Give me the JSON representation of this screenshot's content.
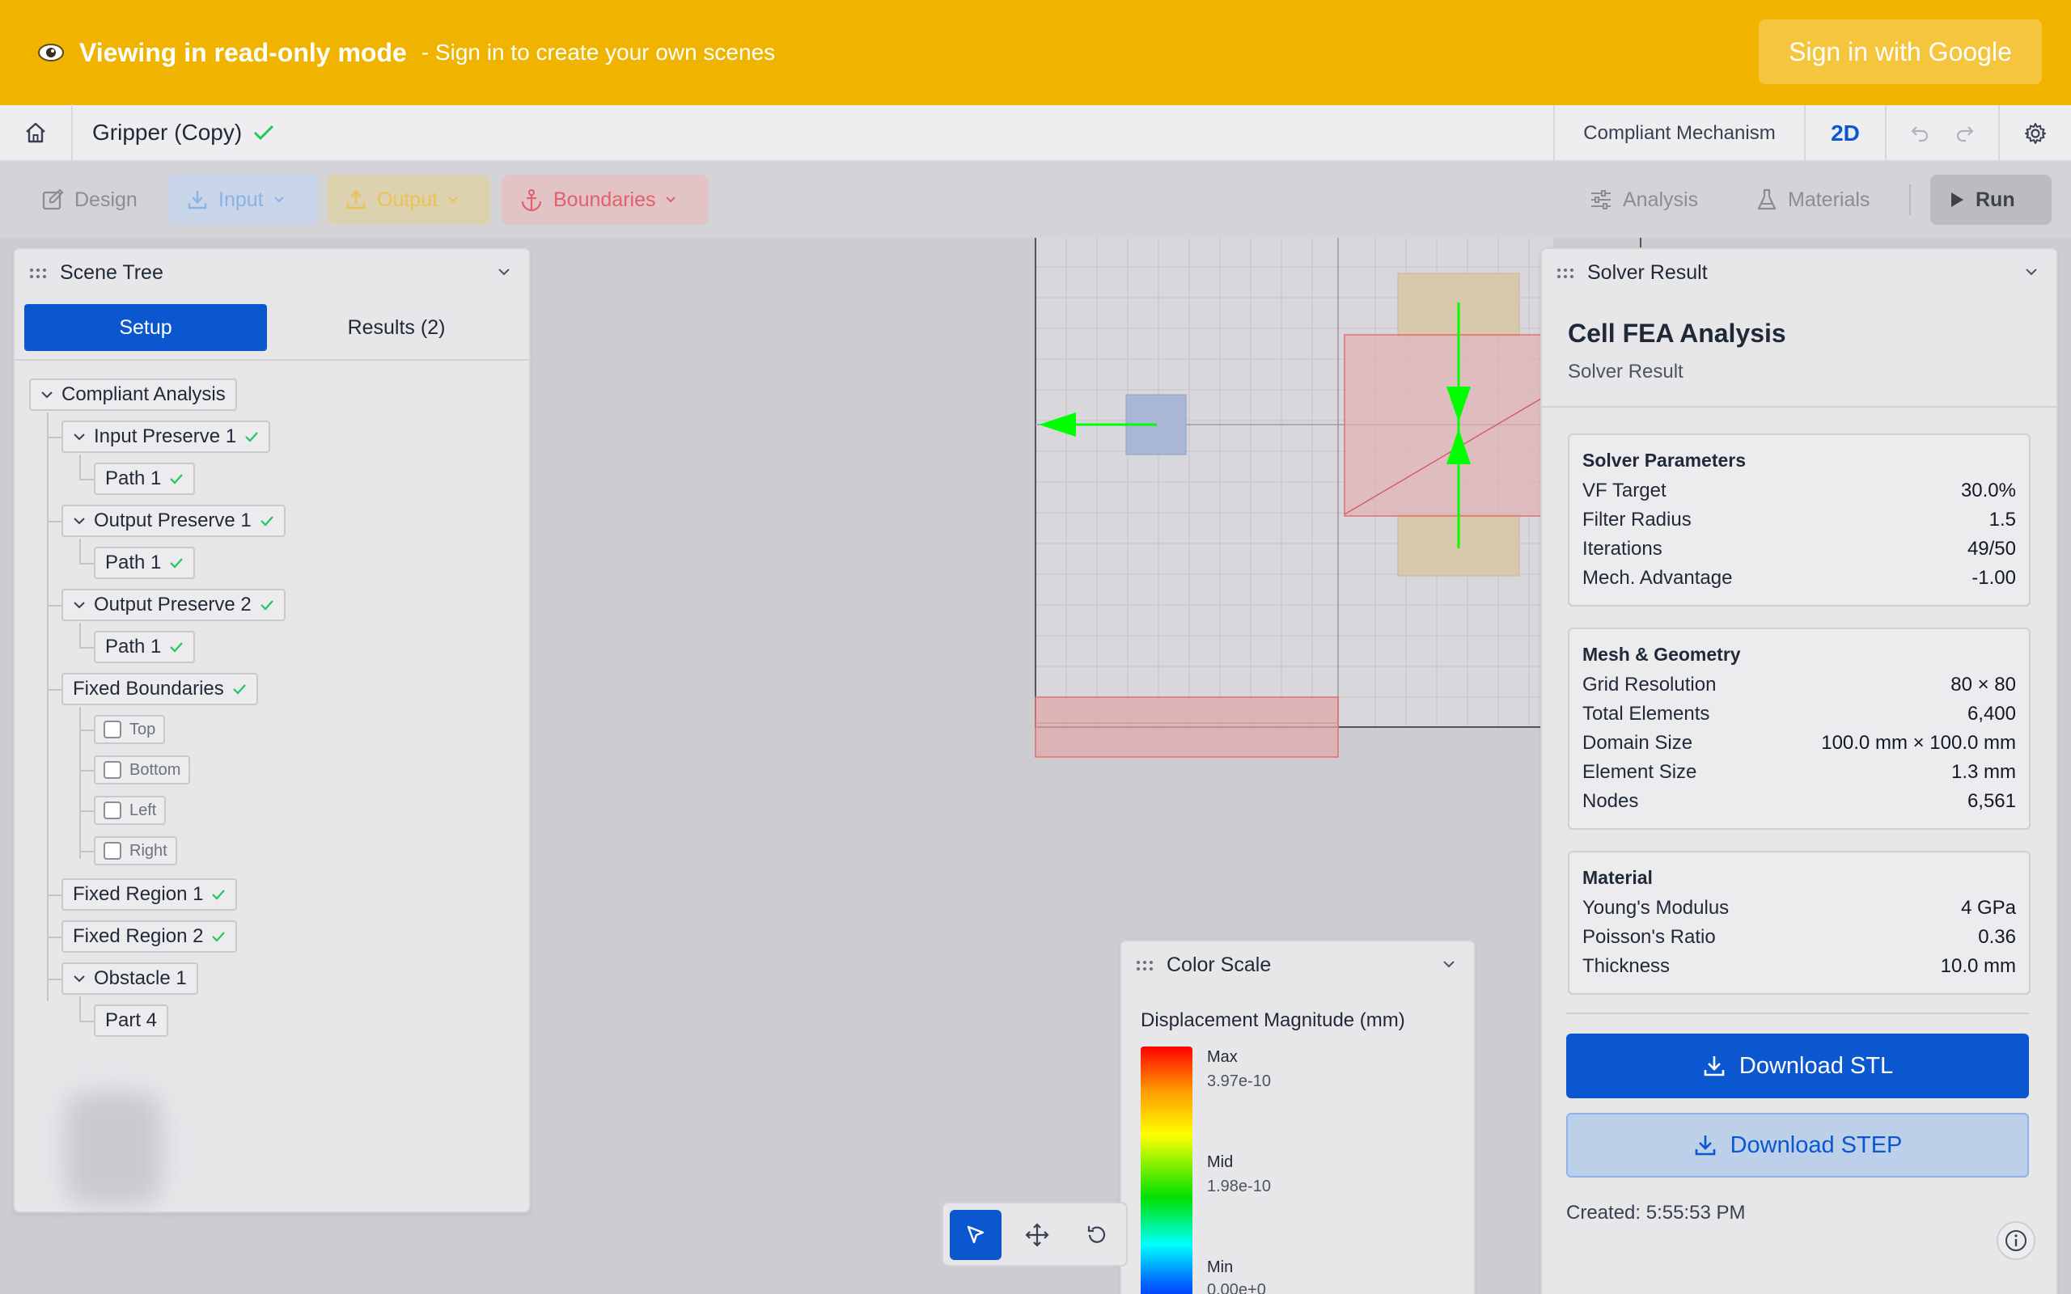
{
  "banner": {
    "title": "Viewing in read-only mode",
    "subtitle": "- Sign in to create your own scenes",
    "signin_label": "Sign in with Google"
  },
  "header": {
    "doc_title": "Gripper (Copy)",
    "mode": "Compliant Mechanism",
    "view": "2D"
  },
  "toolbar": {
    "design": "Design",
    "input": "Input",
    "output": "Output",
    "boundaries": "Boundaries",
    "analysis": "Analysis",
    "materials": "Materials",
    "run": "Run"
  },
  "scene_tree": {
    "title": "Scene Tree",
    "tab_setup": "Setup",
    "tab_results": "Results (2)",
    "root": "Compliant Analysis",
    "input_preserve_1": "Input Preserve 1",
    "output_preserve_1": "Output Preserve 1",
    "output_preserve_2": "Output Preserve 2",
    "path": "Path 1",
    "fixed_boundaries": "Fixed Boundaries",
    "top": "Top",
    "bottom": "Bottom",
    "left": "Left",
    "right": "Right",
    "fixed_region_1": "Fixed Region 1",
    "fixed_region_2": "Fixed Region 2",
    "obstacle_1": "Obstacle 1",
    "part_4": "Part 4"
  },
  "solver": {
    "panel_title": "Solver Result",
    "title": "Cell FEA Analysis",
    "subtitle": "Solver Result",
    "params": {
      "heading": "Solver Parameters",
      "rows": [
        {
          "label": "VF Target",
          "value": "30.0%"
        },
        {
          "label": "Filter Radius",
          "value": "1.5"
        },
        {
          "label": "Iterations",
          "value": "49/50"
        },
        {
          "label": "Mech. Advantage",
          "value": "-1.00"
        }
      ]
    },
    "mesh": {
      "heading": "Mesh & Geometry",
      "rows": [
        {
          "label": "Grid Resolution",
          "value": "80 × 80"
        },
        {
          "label": "Total Elements",
          "value": "6,400"
        },
        {
          "label": "Domain Size",
          "value": "100.0 mm × 100.0 mm"
        },
        {
          "label": "Element Size",
          "value": "1.3 mm"
        },
        {
          "label": "Nodes",
          "value": "6,561"
        }
      ]
    },
    "material": {
      "heading": "Material",
      "rows": [
        {
          "label": "Young's Modulus",
          "value": "4 GPa"
        },
        {
          "label": "Poisson's Ratio",
          "value": "0.36"
        },
        {
          "label": "Thickness",
          "value": "10.0 mm"
        }
      ]
    },
    "download_stl": "Download STL",
    "download_step": "Download STEP",
    "created": "Created: 5:55:53 PM"
  },
  "color_scale": {
    "title": "Color Scale",
    "label": "Displacement Magnitude (mm)",
    "max_label": "Max",
    "max_value": "3.97e-10",
    "mid_label": "Mid",
    "mid_value": "1.98e-10",
    "min_label": "Min",
    "min_value": "0.00e+0"
  },
  "colors": {
    "banner": "#f0b400",
    "primary": "#0b57d0",
    "check": "#22c55e",
    "arrow": "#00ff00"
  }
}
